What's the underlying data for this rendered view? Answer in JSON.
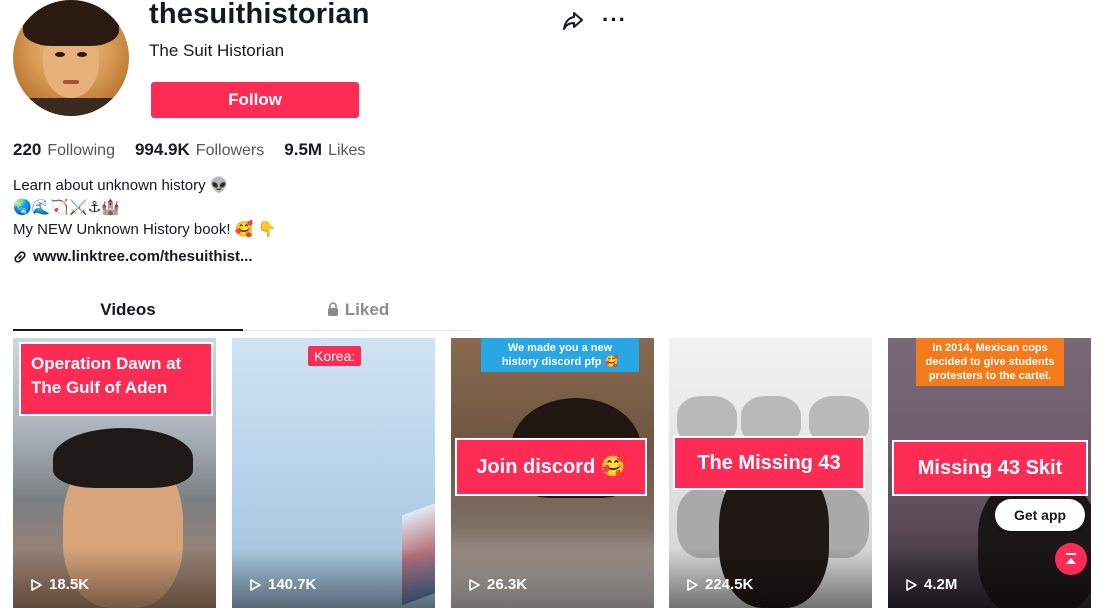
{
  "profile": {
    "username": "thesuithistorian",
    "nickname": "The Suit Historian",
    "follow_label": "Follow"
  },
  "stats": {
    "following_count": "220",
    "following_label": "Following",
    "followers_count": "994.9K",
    "followers_label": "Followers",
    "likes_count": "9.5M",
    "likes_label": "Likes"
  },
  "bio": {
    "line1": "Learn about unknown history 👽",
    "line2": "🌏🌊🏹⚔️⚓🏰",
    "line3": "My NEW Unknown History book! 🥰 👇",
    "link": "www.linktree.com/thesuithist..."
  },
  "tabs": {
    "videos": "Videos",
    "liked": "Liked"
  },
  "videos": [
    {
      "title": "Operation Dawn at The Gulf of Aden",
      "title_line1": "Operation Dawn at",
      "title_line2": "The Gulf of Aden",
      "views": "18.5K"
    },
    {
      "tag": "Korea:",
      "views": "140.7K"
    },
    {
      "caption_line1": "We made you a new",
      "caption_line2": "history discord pfp 🥰",
      "title": "Join discord 🥰",
      "views": "26.3K"
    },
    {
      "title": "The Missing 43",
      "views": "224.5K"
    },
    {
      "caption_line1": "In 2014, Mexican cops",
      "caption_line2": "decided to give students",
      "caption_line3": "protesters to the cartel.",
      "title": "Missing 43 Skit",
      "views": "4.2M"
    }
  ],
  "overlay": {
    "get_app": "Get app"
  },
  "colors": {
    "accent": "#fe2c55",
    "text": "#161823"
  }
}
